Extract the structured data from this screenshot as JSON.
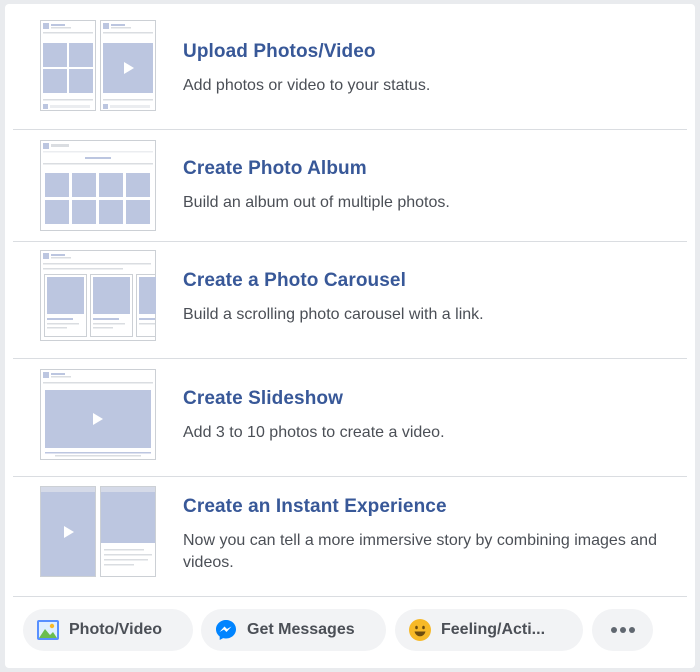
{
  "options": [
    {
      "title": "Upload Photos/Video",
      "description": "Add photos or video to your status.",
      "icon": "upload-photos-thumbnail-icon"
    },
    {
      "title": "Create Photo Album",
      "description": "Build an album out of multiple photos.",
      "icon": "photo-album-thumbnail-icon"
    },
    {
      "title": "Create a Photo Carousel",
      "description": "Build a scrolling photo carousel with a link.",
      "icon": "photo-carousel-thumbnail-icon"
    },
    {
      "title": "Create Slideshow",
      "description": "Add 3 to 10 photos to create a video.",
      "icon": "slideshow-thumbnail-icon"
    },
    {
      "title": "Create an Instant Experience",
      "description": "Now you can tell a more immersive story by combining images and videos.",
      "icon": "instant-experience-thumbnail-icon"
    }
  ],
  "composer_actions": [
    {
      "label": "Photo/Video",
      "icon": "photo-video-icon"
    },
    {
      "label": "Get Messages",
      "icon": "messenger-icon"
    },
    {
      "label": "Feeling/Acti...",
      "icon": "smiley-icon"
    },
    {
      "label": "",
      "icon": "more-dots-icon"
    }
  ],
  "colors": {
    "link_blue": "#385898",
    "placeholder": "#bcc6e0",
    "divider": "#dadde1"
  }
}
